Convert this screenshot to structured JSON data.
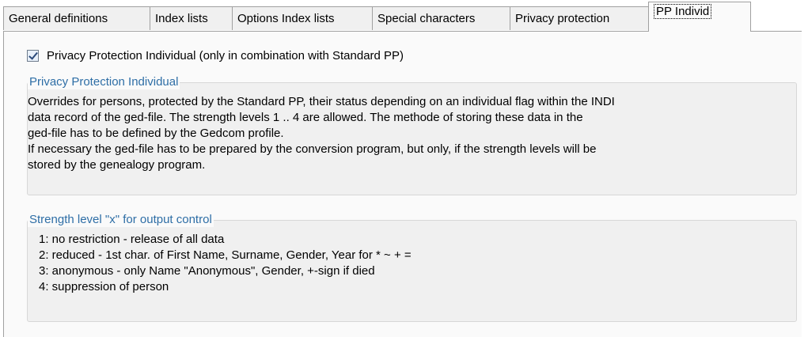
{
  "tabs": [
    {
      "label": "General definitions",
      "active": false
    },
    {
      "label": "Index lists",
      "active": false
    },
    {
      "label": "Options Index lists",
      "active": false
    },
    {
      "label": "Special characters",
      "active": false
    },
    {
      "label": "Privacy protection",
      "active": false
    },
    {
      "label": "PP Individ",
      "active": true
    }
  ],
  "checkbox": {
    "checked": true,
    "label": "Privacy Protection Individual (only in combination with Standard PP)"
  },
  "group_individual": {
    "title": "Privacy Protection Individual",
    "lines": [
      "Overrides for persons, protected by the Standard PP, their status depending on an individual flag within the INDI",
      "data record of the ged-file. The strength levels 1 .. 4 are allowed. The methode of storing these data in the",
      "ged-file has to be defined by the Gedcom profile.",
      "If necessary the ged-file has to be prepared by the conversion program, but only, if the strength levels will be",
      "stored by the genealogy program."
    ]
  },
  "group_strength": {
    "title": "Strength level \"x\" for output control",
    "items": [
      "1:  no restriction - release of all data",
      "2:  reduced - 1st char. of First Name, Surname, Gender, Year for * ~ + =",
      "3:  anonymous - only Name \"Anonymous\", Gender, +-sign if died",
      "4:  suppression of person"
    ]
  },
  "colors": {
    "legend_text": "#2e6ea6",
    "panel_bg": "#fafafa",
    "tab_bg": "#f0f0f0"
  }
}
